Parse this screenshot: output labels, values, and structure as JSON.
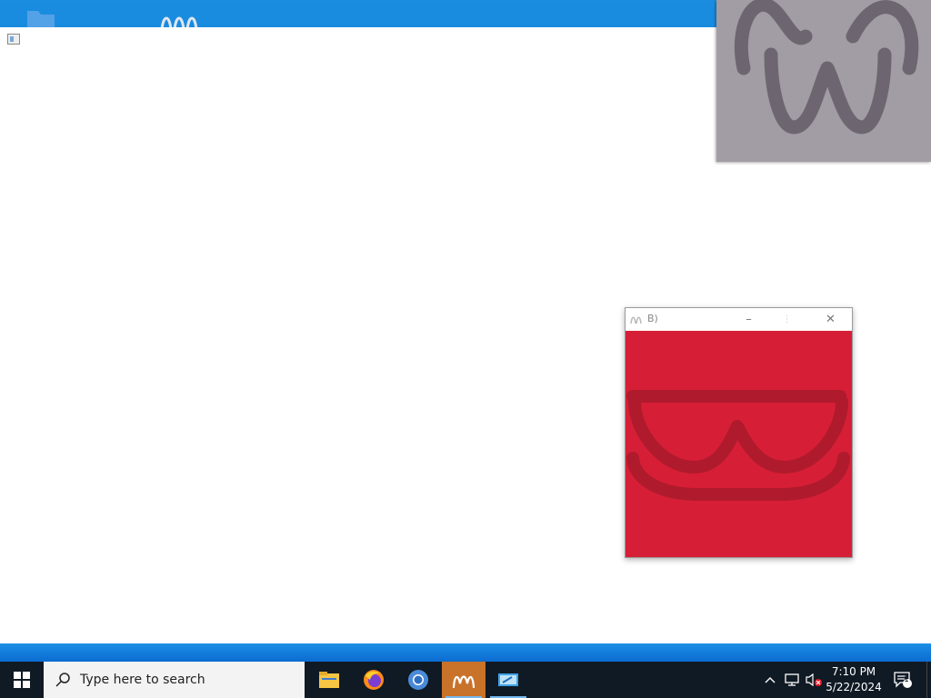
{
  "desktop": {
    "icons": [
      "folder-icon",
      "app-icon"
    ]
  },
  "small_window": {
    "title": "B)",
    "minimize_label": "–",
    "maximize_label": "⋮",
    "close_label": "✕",
    "colors": {
      "content_bg": "#d61f36",
      "glyph": "#b01a2d"
    }
  },
  "thumbnail_window": {
    "colors": {
      "bg": "#a29ca4",
      "glyph": "#6d6670"
    }
  },
  "taskbar": {
    "search_placeholder": "Type here to search",
    "apps": [
      {
        "name": "file-explorer",
        "running": false,
        "active": false
      },
      {
        "name": "firefox",
        "running": false,
        "active": false
      },
      {
        "name": "chrome",
        "running": false,
        "active": false
      },
      {
        "name": "vim-like-app",
        "running": true,
        "active": true
      },
      {
        "name": "remote-desktop",
        "running": true,
        "active": false
      }
    ],
    "tray": {
      "time": "7:10 PM",
      "date": "5/22/2024",
      "notification_count": "1"
    }
  }
}
